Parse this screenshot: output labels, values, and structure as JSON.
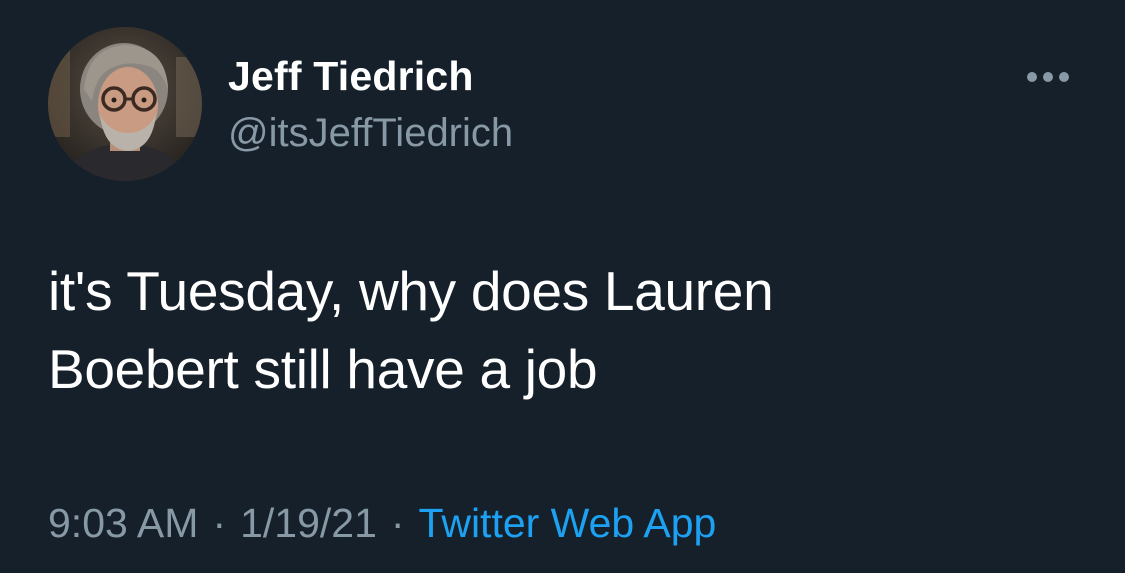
{
  "tweet": {
    "author": {
      "display_name": "Jeff Tiedrich",
      "handle": "@itsJeffTiedrich",
      "avatar_icon": "profile-photo"
    },
    "more_icon": "more-horizontal-icon",
    "text_line_1": "it's Tuesday, why does Lauren",
    "text_line_2": "Boebert still have a job",
    "time": "9:03 AM",
    "date": "1/19/21",
    "separator": "·",
    "source": "Twitter Web App"
  },
  "colors": {
    "background": "#15202b",
    "primary_text": "#ffffff",
    "secondary_text": "#8899a6",
    "link": "#1da1f2"
  }
}
